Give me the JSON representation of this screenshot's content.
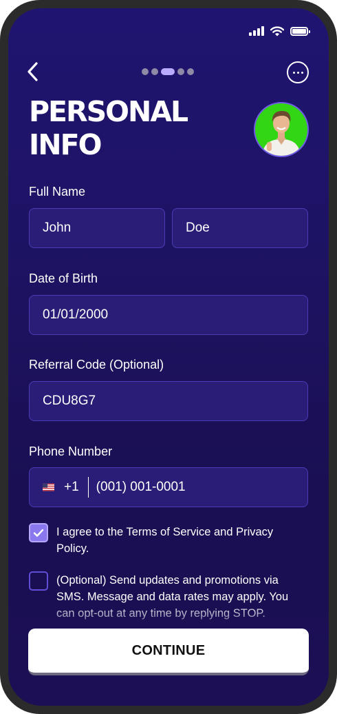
{
  "status_bar": {
    "signal_icon": "cellular-signal-icon",
    "wifi_icon": "wifi-icon",
    "battery_icon": "battery-full-icon"
  },
  "header": {
    "back_icon": "chevron-left-icon",
    "progress": {
      "total_steps": 5,
      "current_step": 3
    },
    "more_icon": "more-horizontal-icon",
    "title_line1": "PERSONAL",
    "title_line2": "INFO"
  },
  "form": {
    "full_name_label": "Full Name",
    "first_name": "John",
    "last_name": "Doe",
    "dob_label": "Date of Birth",
    "dob_value": "01/01/2000",
    "referral_label": "Referral Code (Optional)",
    "referral_value": "CDU8G7",
    "phone_label": "Phone Number",
    "phone_flag": "us-flag-icon",
    "phone_country_code": "+1",
    "phone_value": "(001) 001-0001"
  },
  "consents": {
    "terms_checked": true,
    "terms_text": "I agree to the Terms of Service and Privacy Policy.",
    "sms_checked": false,
    "sms_text": "(Optional) Send updates and promotions via SMS. Message and data rates may apply. You can opt-out at any time by replying STOP."
  },
  "continue_label": "CONTINUE",
  "colors": {
    "accent": "#8a78ef",
    "field_bg": "#2a1d78",
    "field_border": "#4a3cb6",
    "avatar_bg": "#33d615"
  }
}
